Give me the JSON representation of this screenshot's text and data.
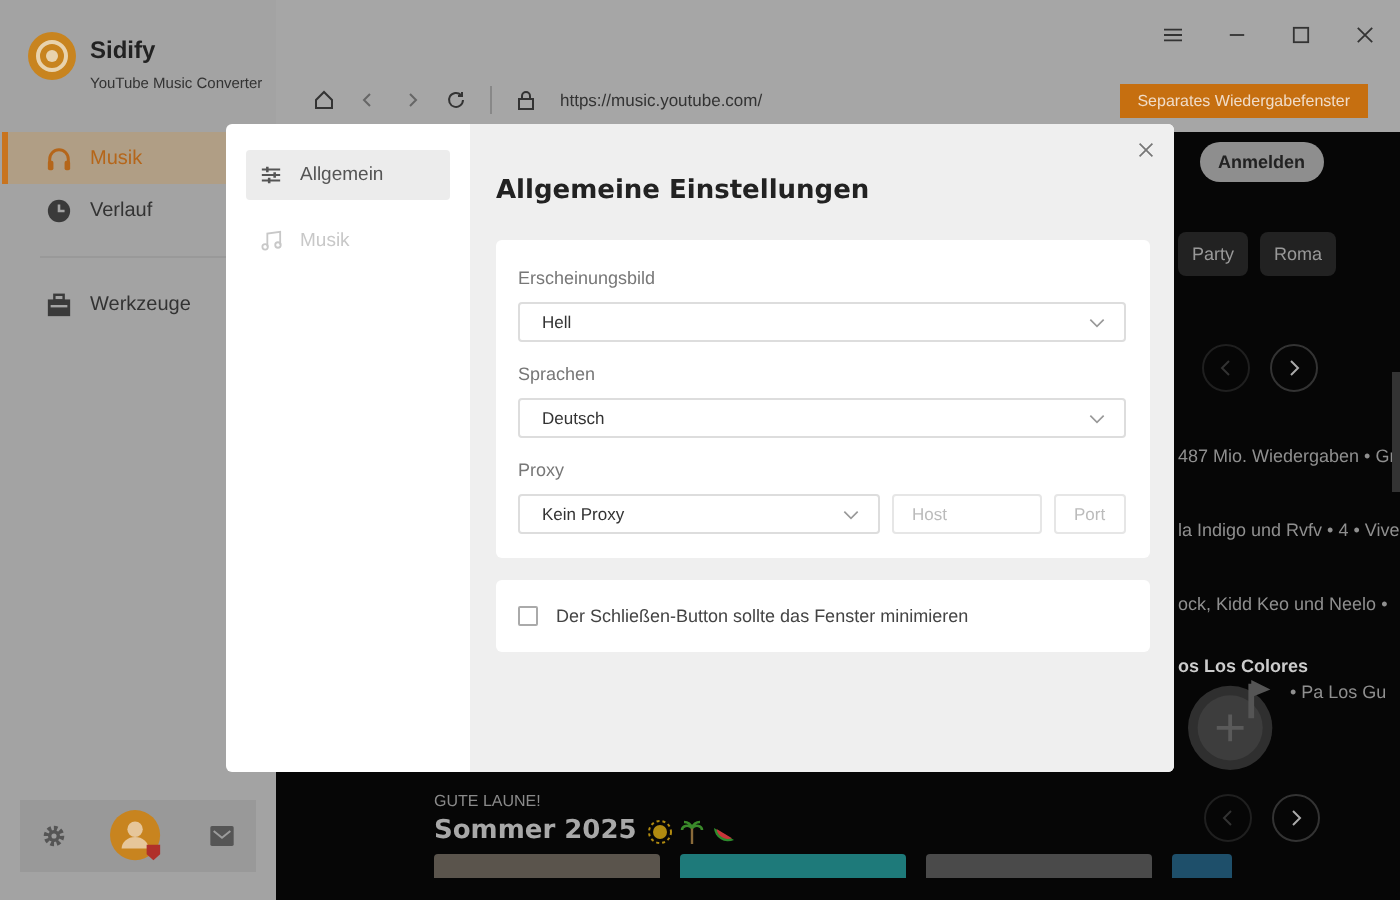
{
  "app": {
    "name": "Sidify",
    "subtitle": "YouTube Music Converter"
  },
  "browser_bar": {
    "url": "https://music.youtube.com/",
    "button": "Separates Wiedergabefenster"
  },
  "sidebar": {
    "sections": [
      [
        {
          "label": "Musik",
          "selected": true
        },
        {
          "label": "Verlauf",
          "selected": false
        }
      ],
      [
        {
          "label": "Werkzeuge",
          "selected": false
        }
      ]
    ]
  },
  "background": {
    "login_button": "Anmelden",
    "chips": [
      "Party",
      "Roma"
    ],
    "lines": [
      "487 Mio. Wiedergaben • Gr",
      "la Indigo und Rvfv • 4 • Vive",
      "ock, Kidd Keo und Neelo •"
    ],
    "title_line": "os Los Colores",
    "sub_line": "• Pa Los Gu",
    "shelf": {
      "eyebrow": "GUTE LAUNE!",
      "title": "Sommer 2025"
    }
  },
  "dialog": {
    "nav": [
      {
        "label": "Allgemein",
        "selected": true
      },
      {
        "label": "Musik",
        "selected": false
      }
    ],
    "title": "Allgemeine Einstellungen",
    "fields": [
      {
        "label": "Erscheinungsbild",
        "value": "Hell"
      },
      {
        "label": "Sprachen",
        "value": "Deutsch"
      }
    ],
    "proxy": {
      "label": "Proxy",
      "value": "Kein Proxy",
      "host_placeholder": "Host",
      "port_placeholder": "Port"
    },
    "option": {
      "label": "Der Schließen-Button sollte das Fenster minimieren",
      "checked": false
    }
  }
}
